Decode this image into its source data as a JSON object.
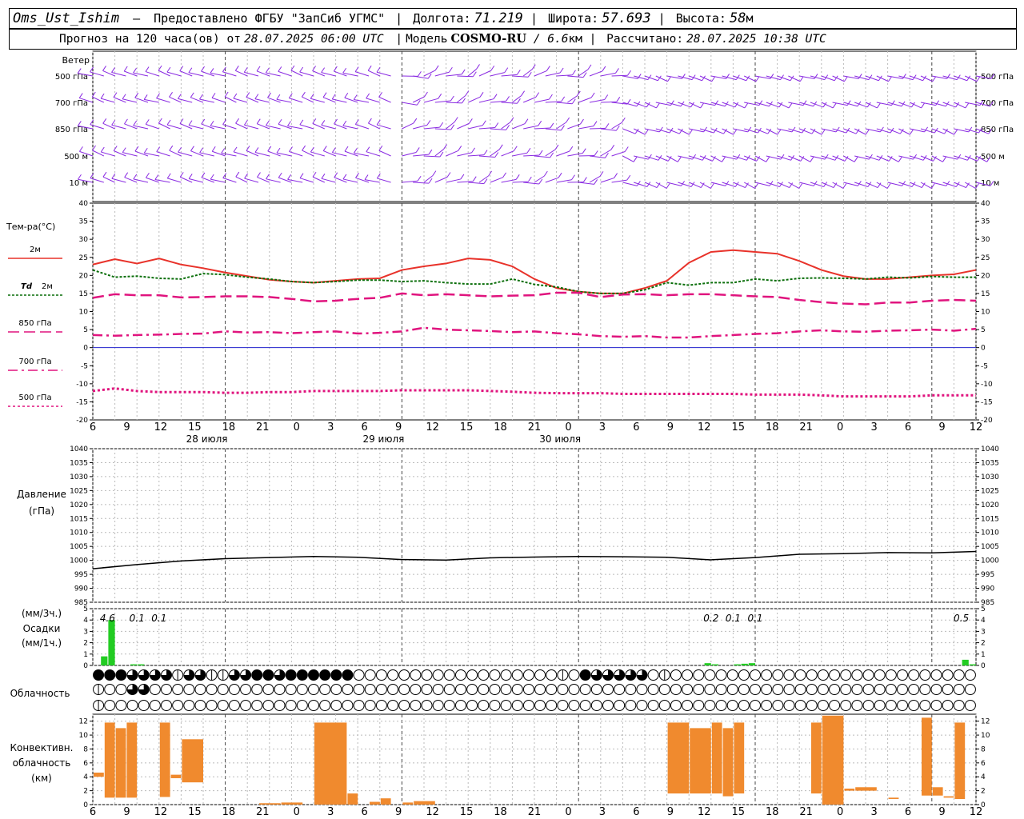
{
  "header": {
    "station": "Oms_Ust_Ishim",
    "provider": "Предоставлено ФГБУ \"ЗапСиб УГМС\"",
    "lon_label": "Долгота:",
    "lon_value": "71.219",
    "lat_label": "Широта:",
    "lat_value": "57.693",
    "alt_label": "Высота:",
    "alt_value": "58",
    "alt_unit": "м",
    "forecast_prefix": "Прогноз на 120 часа(ов) от",
    "forecast_time": "28.07.2025 06:00 UTC",
    "model_label": "Модель",
    "model_name": "COSMO-RU",
    "model_res": "6.6",
    "model_res_unit": "км",
    "calc_label": "Рассчитано:",
    "calc_time": "28.07.2025 10:38 UTC"
  },
  "colors": {
    "wind": "#8a2be2",
    "t2m": "#e8322a",
    "td2m": "#0a6e0a",
    "t850": "#e0147e",
    "t700": "#e0147e",
    "t500": "#e0147e",
    "zero_line": "#2222cc",
    "precip": "#22cc22",
    "conv": "#f08a2e",
    "grid": "#bbbbbb"
  },
  "chart_data": [
    {
      "type": "wind-barbs",
      "panel_label": "Ветер",
      "levels": [
        "500 гПа",
        "700 гПа",
        "850 гПа",
        "500 м",
        "10 м"
      ]
    },
    {
      "type": "line",
      "ylabel": "Тем-ра(°С)",
      "ylim": [
        -20,
        40
      ],
      "yticks": [
        -20,
        -15,
        -10,
        -5,
        0,
        5,
        10,
        15,
        20,
        25,
        30,
        35,
        40
      ],
      "x_hours_from_start": [
        0,
        3,
        6,
        9,
        12,
        15,
        18,
        21,
        24,
        27,
        30,
        33,
        36,
        39,
        42,
        45,
        48,
        51,
        54,
        57,
        60,
        63,
        66,
        69,
        72,
        75,
        78,
        81,
        84,
        87,
        90,
        93,
        96,
        99,
        102,
        105,
        108,
        111,
        114,
        117,
        120
      ],
      "series": [
        {
          "name": "2м",
          "values": [
            23,
            24.5,
            23.3,
            24.7,
            23,
            22,
            20.8,
            19.8,
            18.8,
            18.3,
            18,
            18.5,
            19,
            19.2,
            21.5,
            22.5,
            23.3,
            24.7,
            24.3,
            22.5,
            19,
            16.5,
            15.5,
            15,
            15,
            16.5,
            18.5,
            23.5,
            26.5,
            27,
            26.5,
            26,
            24,
            21.5,
            19.8,
            19,
            19,
            19.5,
            20,
            20.3,
            21.5
          ]
        },
        {
          "name": "Td 2м",
          "values": [
            21.5,
            19.5,
            19.8,
            19.2,
            19,
            20.5,
            20.2,
            19.5,
            19,
            18.3,
            18,
            18.3,
            18.7,
            18.7,
            18.3,
            18.5,
            18,
            17.6,
            17.6,
            19,
            17.5,
            16.8,
            15.5,
            15,
            15,
            16,
            18,
            17.3,
            18,
            18,
            19,
            18.5,
            19.2,
            19.3,
            19.2,
            19,
            19.5,
            19.3,
            19.7,
            19.5,
            19.5
          ]
        },
        {
          "name": "850 гПа",
          "values": [
            13.8,
            14.8,
            14.5,
            14.5,
            13.9,
            14,
            14.2,
            14.2,
            14,
            13.5,
            12.8,
            13,
            13.5,
            13.8,
            15,
            14.5,
            14.8,
            14.5,
            14.2,
            14.4,
            14.5,
            15.2,
            15.2,
            14,
            14.7,
            14.8,
            14.5,
            14.8,
            14.8,
            14.5,
            14.2,
            14,
            13.2,
            12.6,
            12.2,
            12,
            12.5,
            12.5,
            13,
            13.2,
            13
          ]
        },
        {
          "name": "700 гПа",
          "values": [
            3.5,
            3.3,
            3.5,
            3.6,
            3.8,
            3.9,
            4.5,
            4.2,
            4.3,
            4,
            4.3,
            4.5,
            3.9,
            4.1,
            4.5,
            5.5,
            5,
            4.8,
            4.6,
            4.3,
            4.5,
            4,
            3.7,
            3.2,
            3,
            3.2,
            2.8,
            2.8,
            3.2,
            3.5,
            3.8,
            4,
            4.5,
            4.8,
            4.5,
            4.4,
            4.7,
            4.8,
            5,
            4.7,
            5.2
          ]
        },
        {
          "name": "500 гПа",
          "values": [
            -12,
            -11.3,
            -12,
            -12.3,
            -12.3,
            -12.3,
            -12.5,
            -12.5,
            -12.3,
            -12.3,
            -12,
            -12,
            -12,
            -12,
            -11.8,
            -11.8,
            -11.8,
            -11.8,
            -12,
            -12.2,
            -12.5,
            -12.6,
            -12.6,
            -12.6,
            -12.8,
            -12.8,
            -12.8,
            -12.8,
            -12.8,
            -12.8,
            -13,
            -13,
            -13,
            -13.2,
            -13.5,
            -13.5,
            -13.5,
            -13.5,
            -13.2,
            -13.2,
            -13.2
          ]
        }
      ]
    },
    {
      "type": "line",
      "ylabel": "Давление",
      "ylabel2": "(гПа)",
      "ylim": [
        985,
        1040
      ],
      "yticks": [
        985,
        990,
        995,
        1000,
        1005,
        1010,
        1015,
        1020,
        1025,
        1030,
        1035,
        1040
      ],
      "x_hours_from_start": [
        0,
        6,
        12,
        18,
        24,
        30,
        36,
        42,
        48,
        54,
        60,
        66,
        72,
        78,
        84,
        90,
        96,
        102,
        108,
        114,
        120
      ],
      "series": [
        {
          "values": [
            997,
            998.5,
            999.8,
            1000.6,
            1001,
            1001.4,
            1001.1,
            1000.3,
            1000.1,
            1000.9,
            1001.2,
            1001.4,
            1001.3,
            1001.1,
            1000.2,
            1001,
            1002.2,
            1002.4,
            1002.8,
            1002.7,
            1003.2
          ]
        }
      ]
    },
    {
      "type": "bar",
      "ylabel": "(мм/3ч.)",
      "ylabel2": "Осадки",
      "ylabel3": "(мм/1ч.)",
      "ylim": [
        0,
        5
      ],
      "yticks": [
        0,
        1,
        2,
        3,
        4,
        5
      ],
      "bars": [
        {
          "h": 2,
          "v": 0.8
        },
        {
          "h": 3,
          "v": 4.0
        },
        {
          "h": 6,
          "v": 0.1
        },
        {
          "h": 7,
          "v": 0.1
        },
        {
          "h": 84,
          "v": 0.2
        },
        {
          "h": 85,
          "v": 0.1
        },
        {
          "h": 88,
          "v": 0.1
        },
        {
          "h": 89,
          "v": 0.15
        },
        {
          "h": 90,
          "v": 0.2
        },
        {
          "h": 119,
          "v": 0.5
        },
        {
          "h": 120,
          "v": 0.1
        }
      ],
      "totals": [
        {
          "h": 2,
          "label": "4.6"
        },
        {
          "h": 6,
          "label": "0.1"
        },
        {
          "h": 9,
          "label": "0.1"
        },
        {
          "h": 84,
          "label": "0.2"
        },
        {
          "h": 87,
          "label": "0.1"
        },
        {
          "h": 90,
          "label": "0.1"
        },
        {
          "h": 118,
          "label": "0.5"
        }
      ]
    },
    {
      "type": "cloud-symbols",
      "ylabel": "Облачность",
      "rows": [
        "4443333233223344344444400000000000000000020433333020000000000000000000000000002044444444444444444444441444444224443434444444",
        "2003300000000000000000000000000000000000000000000000000000000000000000000000000000000000000000000000000000000000000000000000",
        "2000000000000000000000000000000000000000000000000000000000000000000000000000000000000000000000000000000000000000000000000000"
      ]
    },
    {
      "type": "bar",
      "ylabel": "Конвективн.",
      "ylabel2": "облачность",
      "ylabel3": "(км)",
      "ylim": [
        0,
        13
      ],
      "yticks": [
        0,
        2,
        4,
        6,
        8,
        10,
        12
      ],
      "ranges": [
        [
          0,
          1,
          4,
          4.6
        ],
        [
          1,
          2,
          1,
          11.8
        ],
        [
          2,
          3,
          1,
          11
        ],
        [
          3,
          4,
          1,
          11.8
        ],
        [
          6,
          7,
          1.1,
          11.8
        ],
        [
          7,
          8,
          3.8,
          4.3
        ],
        [
          8,
          10,
          3.2,
          9.4
        ],
        [
          15,
          17,
          0,
          0.2
        ],
        [
          17,
          19,
          0,
          0.3
        ],
        [
          20,
          23,
          0,
          11.8
        ],
        [
          23,
          24,
          0,
          1.6
        ],
        [
          25,
          26,
          0,
          0.4
        ],
        [
          26,
          27,
          0,
          0.9
        ],
        [
          28,
          29,
          0,
          0.3
        ],
        [
          29,
          31,
          0,
          0.5
        ],
        [
          52,
          54,
          1.6,
          11.8
        ],
        [
          54,
          56,
          1.6,
          11
        ],
        [
          56,
          57,
          1.6,
          11.8
        ],
        [
          57,
          58,
          1.2,
          11
        ],
        [
          58,
          59,
          1.6,
          11.8
        ],
        [
          65,
          66,
          1.6,
          11.8
        ],
        [
          66,
          68,
          0,
          12.8
        ],
        [
          68,
          69,
          2,
          2.3
        ],
        [
          69,
          71,
          2,
          2.5
        ],
        [
          72,
          73,
          0.8,
          1
        ],
        [
          75,
          76,
          1.3,
          12.5
        ],
        [
          76,
          77,
          1.3,
          2.5
        ],
        [
          77,
          78,
          1,
          1.2
        ],
        [
          78,
          79,
          0.8,
          11.8
        ]
      ]
    }
  ],
  "axis": {
    "hour_ticks": [
      "6",
      "9",
      "12",
      "15",
      "18",
      "21",
      "0",
      "3",
      "6",
      "9",
      "12",
      "15",
      "18",
      "21",
      "0",
      "3",
      "6",
      "9",
      "12",
      "15",
      "18",
      "21",
      "0",
      "3",
      "6",
      "9",
      "12"
    ],
    "dates": [
      {
        "hour": 12,
        "label": "28 июля"
      },
      {
        "hour": 36,
        "label": "29 июля"
      },
      {
        "hour": 60,
        "label": "30 июля"
      }
    ]
  }
}
